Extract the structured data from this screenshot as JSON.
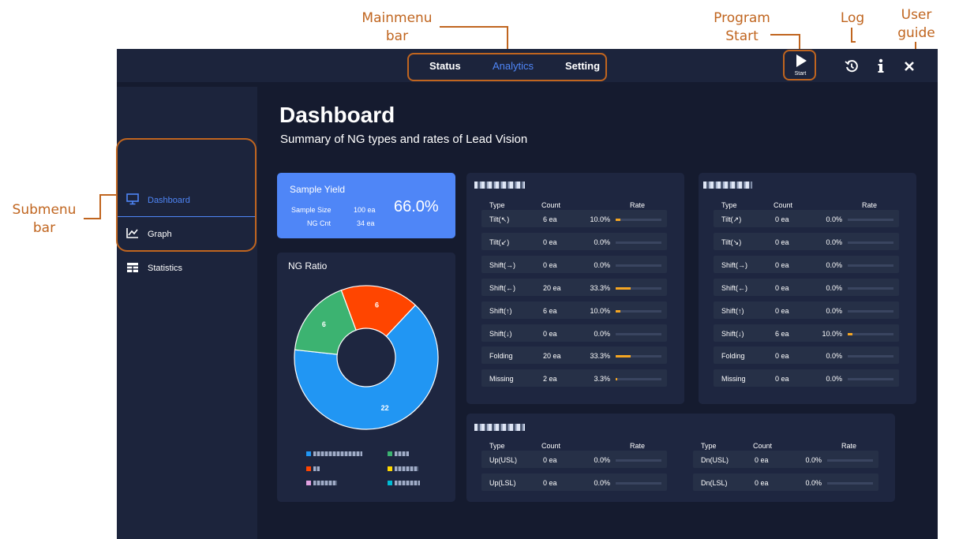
{
  "annotations": {
    "mainmenu": "Mainmenu\nbar",
    "program_start": "Program\nStart",
    "log": "Log",
    "user_guide": "User\nguide",
    "submenu": "Submenu\nbar"
  },
  "topbar": {
    "menu": [
      "Status",
      "Analytics",
      "Setting"
    ],
    "active_menu": "Analytics",
    "start_label": "Start",
    "icons": [
      "play-icon",
      "history-icon",
      "info-icon",
      "close-icon"
    ]
  },
  "sidebar": {
    "items": [
      {
        "label": "Dashboard",
        "icon": "monitor-icon",
        "active": true
      },
      {
        "label": "Graph",
        "icon": "line-chart-icon",
        "active": false
      },
      {
        "label": "Statistics",
        "icon": "table-icon",
        "active": false
      }
    ]
  },
  "page": {
    "title": "Dashboard",
    "subtitle": "Summary of NG types and rates of Lead Vision"
  },
  "yield": {
    "title": "Sample Yield",
    "sample_size_label": "Sample Size",
    "sample_size_value": "100 ea",
    "ng_cnt_label": "NG Cnt",
    "ng_cnt_value": "34 ea",
    "percent": "66.0%"
  },
  "ng_ratio": {
    "title": "NG Ratio",
    "colors": {
      "blue": "#2196f3",
      "green": "#3cb371",
      "orange": "#ff4500",
      "pink": "#e0a0e0",
      "yellow": "#ffd700",
      "cyan": "#00bcd4"
    }
  },
  "chart_data": {
    "type": "pie",
    "title": "NG Ratio",
    "slices": [
      {
        "value": 22,
        "color": "#2196f3"
      },
      {
        "value": 6,
        "color": "#3cb371"
      },
      {
        "value": 6,
        "color": "#ff4500"
      }
    ],
    "donut": true
  },
  "columns": {
    "type": "Type",
    "count": "Count",
    "rate": "Rate"
  },
  "table1": {
    "rows": [
      {
        "type": "Tilt(↖)",
        "count": "6  ea",
        "rate": "10.0%",
        "fill": 0.1
      },
      {
        "type": "Tilt(↙)",
        "count": "0  ea",
        "rate": "0.0%",
        "fill": 0
      },
      {
        "type": "Shift(→)",
        "count": "0  ea",
        "rate": "0.0%",
        "fill": 0
      },
      {
        "type": "Shift(←)",
        "count": "20  ea",
        "rate": "33.3%",
        "fill": 0.333
      },
      {
        "type": "Shift(↑)",
        "count": "6  ea",
        "rate": "10.0%",
        "fill": 0.1
      },
      {
        "type": "Shift(↓)",
        "count": "0  ea",
        "rate": "0.0%",
        "fill": 0
      },
      {
        "type": "Folding",
        "count": "20  ea",
        "rate": "33.3%",
        "fill": 0.333
      },
      {
        "type": "Missing",
        "count": "2  ea",
        "rate": "3.3%",
        "fill": 0.033
      }
    ]
  },
  "table2": {
    "rows": [
      {
        "type": "Tilt(↗)",
        "count": "0  ea",
        "rate": "0.0%",
        "fill": 0
      },
      {
        "type": "Tilt(↘)",
        "count": "0  ea",
        "rate": "0.0%",
        "fill": 0
      },
      {
        "type": "Shift(→)",
        "count": "0  ea",
        "rate": "0.0%",
        "fill": 0
      },
      {
        "type": "Shift(←)",
        "count": "0  ea",
        "rate": "0.0%",
        "fill": 0
      },
      {
        "type": "Shift(↑)",
        "count": "0  ea",
        "rate": "0.0%",
        "fill": 0
      },
      {
        "type": "Shift(↓)",
        "count": "6  ea",
        "rate": "10.0%",
        "fill": 0.1
      },
      {
        "type": "Folding",
        "count": "0  ea",
        "rate": "0.0%",
        "fill": 0
      },
      {
        "type": "Missing",
        "count": "0  ea",
        "rate": "0.0%",
        "fill": 0
      }
    ]
  },
  "table3": {
    "left": [
      {
        "type": "Up(USL)",
        "count": "0  ea",
        "rate": "0.0%",
        "fill": 0
      },
      {
        "type": "Up(LSL)",
        "count": "0  ea",
        "rate": "0.0%",
        "fill": 0
      }
    ],
    "right": [
      {
        "type": "Dn(USL)",
        "count": "0  ea",
        "rate": "0.0%",
        "fill": 0
      },
      {
        "type": "Dn(LSL)",
        "count": "0  ea",
        "rate": "0.0%",
        "fill": 0
      }
    ]
  }
}
